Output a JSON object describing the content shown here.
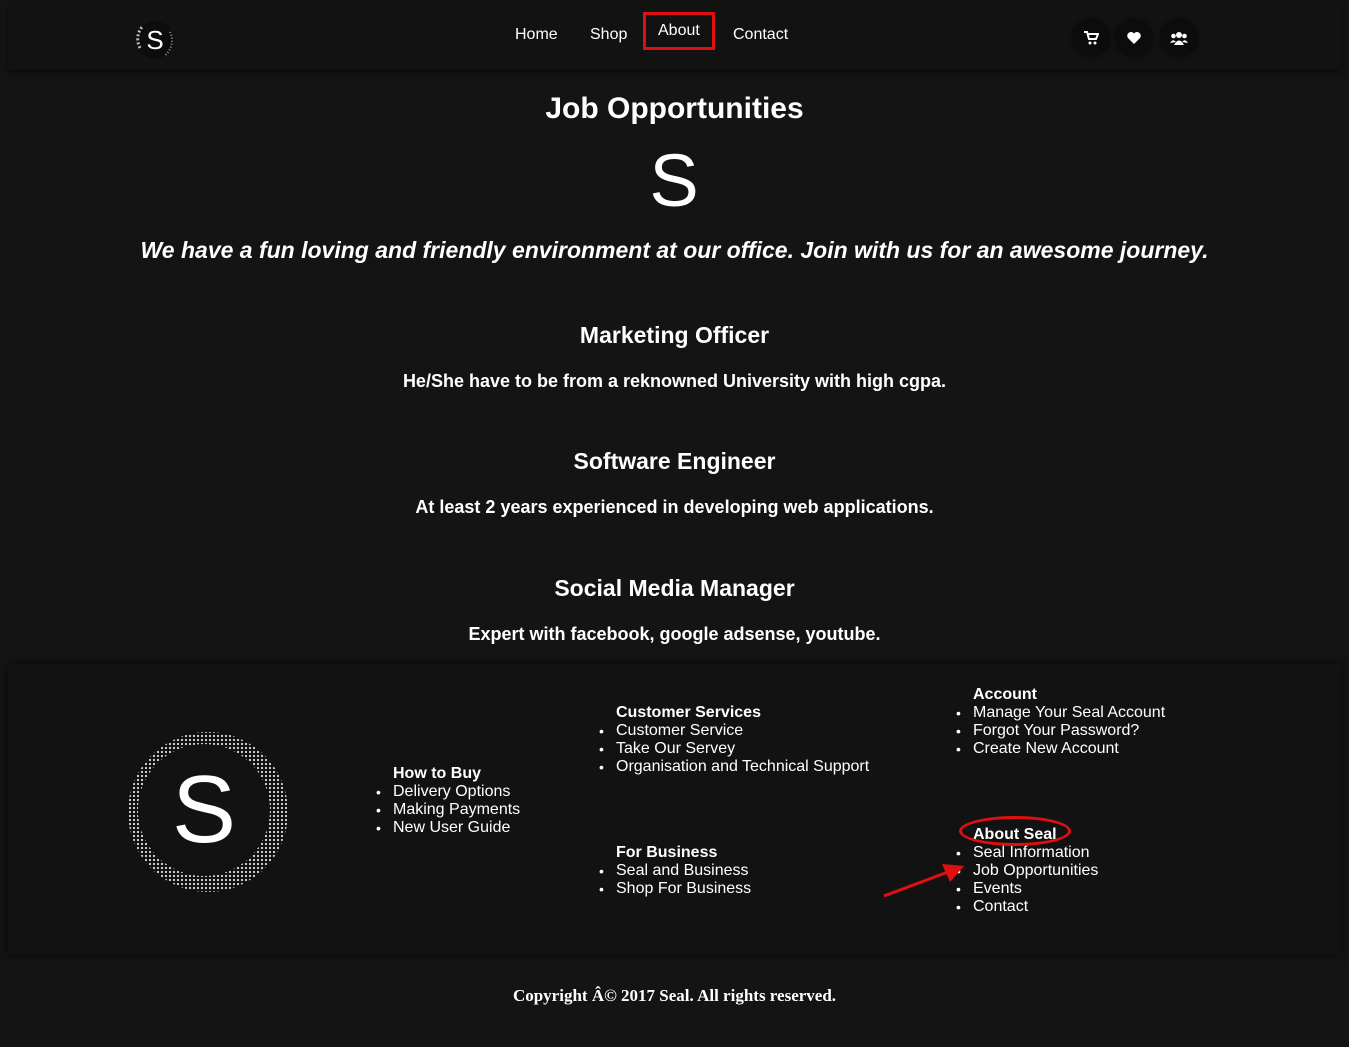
{
  "header": {
    "nav": [
      "Home",
      "Shop",
      "About",
      "Contact"
    ],
    "active": "About",
    "icons": [
      "cart-icon",
      "heart-icon",
      "users-icon"
    ]
  },
  "main": {
    "title": "Job Opportunities",
    "tagline": "We have a fun loving and friendly environment at our office. Join with us for an awesome journey.",
    "jobs": [
      {
        "title": "Marketing Officer",
        "desc": "He/She have to be from a reknowned University with high cgpa."
      },
      {
        "title": "Software Engineer",
        "desc": "At least 2 years experienced in developing web applications."
      },
      {
        "title": "Social Media Manager",
        "desc": "Expert with facebook, google adsense, youtube."
      }
    ]
  },
  "footer": {
    "how_to_buy": {
      "heading": "How to Buy",
      "items": [
        "Delivery Options",
        "Making Payments",
        "New User Guide"
      ]
    },
    "customer_services": {
      "heading": "Customer Services",
      "items": [
        "Customer Service",
        "Take Our Servey",
        "Organisation and Technical Support"
      ]
    },
    "for_business": {
      "heading": "For Business",
      "items": [
        "Seal and Business",
        "Shop For Business"
      ]
    },
    "account": {
      "heading": "Account",
      "items": [
        "Manage Your Seal Account",
        "Forgot Your Password?",
        "Create New Account"
      ]
    },
    "about_seal": {
      "heading": "About Seal",
      "items": [
        "Seal Information",
        "Job Opportunities",
        "Events",
        "Contact"
      ]
    }
  },
  "copyright": "Copyright Â© 2017 Seal. All rights reserved.",
  "colors": {
    "background": "#141414",
    "annotation": "#e01010"
  }
}
